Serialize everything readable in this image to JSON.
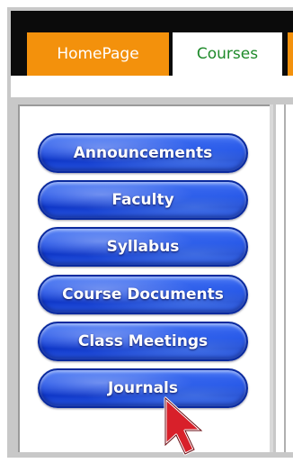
{
  "tabs": [
    {
      "label": "HomePage"
    },
    {
      "label": "Courses"
    }
  ],
  "sidebar": {
    "items": [
      {
        "label": "Announcements"
      },
      {
        "label": "Faculty"
      },
      {
        "label": "Syllabus"
      },
      {
        "label": "Course Documents"
      },
      {
        "label": "Class Meetings"
      },
      {
        "label": "Journals"
      }
    ]
  },
  "colors": {
    "tab_active_bg": "#f3910c",
    "tab_selected_text": "#1e8a2a",
    "button_blue": "#1e4fe6",
    "cursor_red": "#d8202a"
  },
  "icons": {
    "cursor": "arrow-cursor-icon"
  }
}
